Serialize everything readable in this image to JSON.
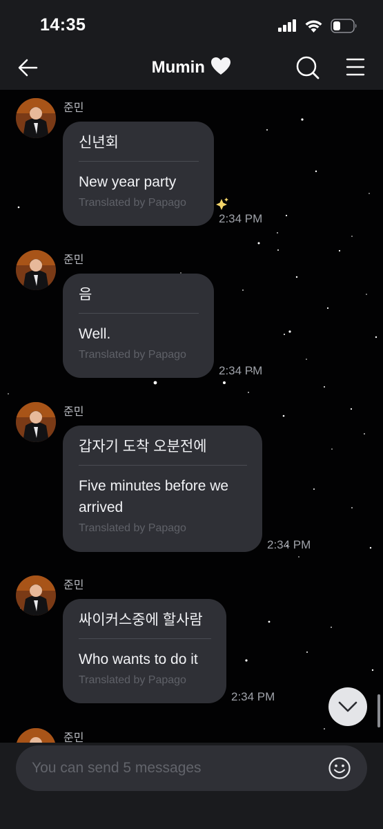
{
  "status_bar": {
    "time": "14:35",
    "icons": [
      "cellular-signal-icon",
      "wifi-icon",
      "battery-icon"
    ]
  },
  "header": {
    "title": "Mumin",
    "title_emoji": "white-heart-icon",
    "actions": [
      "back-arrow-icon",
      "search-icon",
      "menu-icon"
    ]
  },
  "messages": [
    {
      "sender": "준민",
      "original": "신년회",
      "translated": "New year party",
      "credit": "Translated by Papago",
      "time": "2:34 PM"
    },
    {
      "sender": "준민",
      "original": "음",
      "translated": "Well.",
      "credit": "Translated by Papago",
      "time": "2:34 PM"
    },
    {
      "sender": "준민",
      "original": "갑자기 도착 오분전에",
      "translated": "Five minutes before we arrived",
      "credit": "Translated by Papago",
      "time": "2:34 PM"
    },
    {
      "sender": "준민",
      "original": "싸이커스중에 할사람",
      "translated": "Who wants to do it",
      "credit": "Translated by Papago",
      "time": "2:34 PM"
    },
    {
      "sender": "준민"
    }
  ],
  "composer": {
    "placeholder": "You can send 5 messages",
    "emoji_icon": "smiley-face-icon"
  },
  "colors": {
    "bar_background": "#1a1b1e",
    "bubble": "#2f3036",
    "chat_background": "#020203",
    "secondary_text": "#9fa2a9"
  }
}
